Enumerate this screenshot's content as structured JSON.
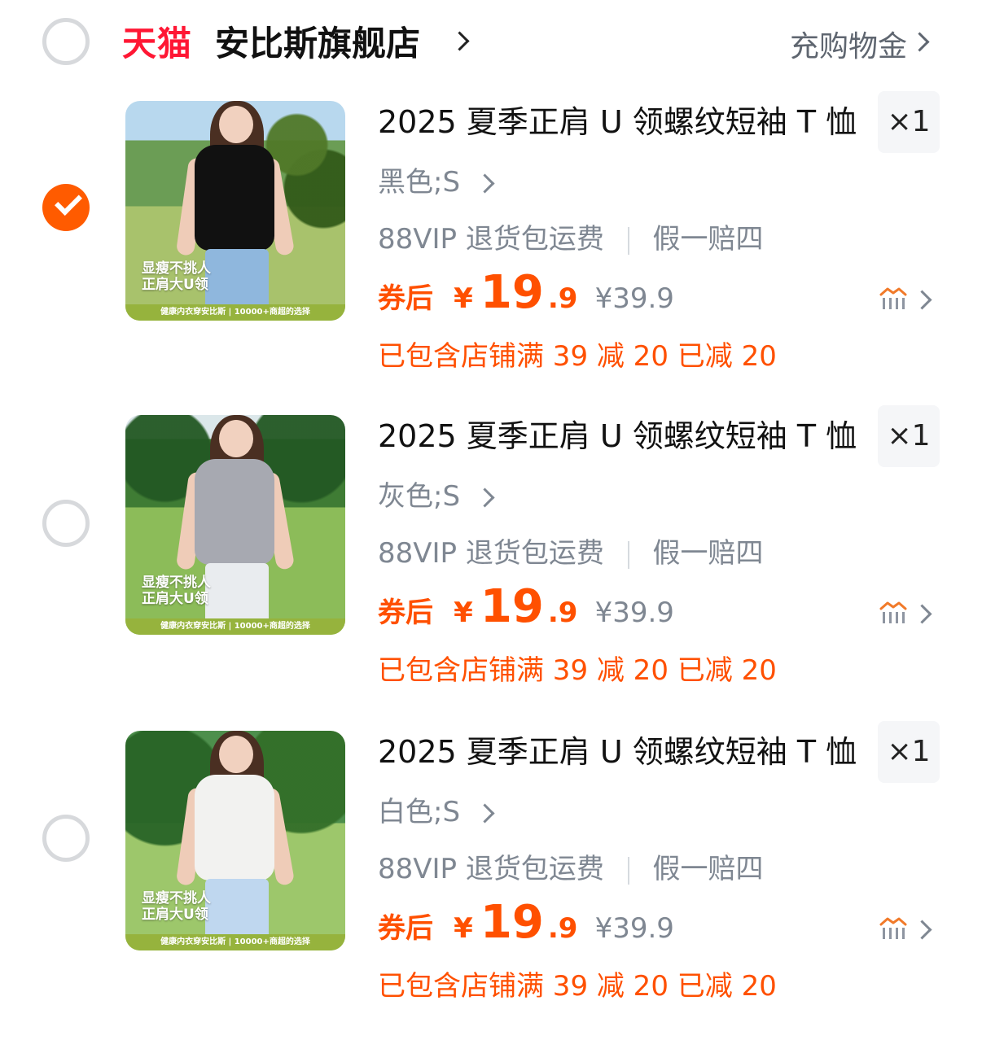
{
  "shop": {
    "platform": "天猫",
    "name": "安比斯旗舰店",
    "link_label": "充购物金"
  },
  "items": [
    {
      "selected": true,
      "title": "2025 夏季正肩 U 领螺纹短袖 T 恤",
      "quantity": "×1",
      "variant": "黑色;S",
      "service_1": "88VIP 退货包运费",
      "service_2": "假一赔四",
      "price_label": "券后",
      "currency": "¥",
      "price_int": "19",
      "price_dec": ".9",
      "original_price": "¥39.9",
      "promo": "已包含店铺满 39 减 20 已减 20",
      "image_text_1": "显瘦不挑人",
      "image_text_2": "正肩大U领",
      "image_footer": "健康内衣穿安比斯 | 10000+商超的选择"
    },
    {
      "selected": false,
      "title": "2025 夏季正肩 U 领螺纹短袖 T 恤",
      "quantity": "×1",
      "variant": "灰色;S",
      "service_1": "88VIP 退货包运费",
      "service_2": "假一赔四",
      "price_label": "券后",
      "currency": "¥",
      "price_int": "19",
      "price_dec": ".9",
      "original_price": "¥39.9",
      "promo": "已包含店铺满 39 减 20 已减 20",
      "image_text_1": "显瘦不挑人",
      "image_text_2": "正肩大U领",
      "image_footer": "健康内衣穿安比斯 | 10000+商超的选择"
    },
    {
      "selected": false,
      "title": "2025 夏季正肩 U 领螺纹短袖 T 恤",
      "quantity": "×1",
      "variant": "白色;S",
      "service_1": "88VIP 退货包运费",
      "service_2": "假一赔四",
      "price_label": "券后",
      "currency": "¥",
      "price_int": "19",
      "price_dec": ".9",
      "original_price": "¥39.9",
      "promo": "已包含店铺满 39 减 20 已减 20",
      "image_text_1": "显瘦不挑人",
      "image_text_2": "正肩大U领",
      "image_footer": "健康内衣穿安比斯 | 10000+商超的选择"
    }
  ],
  "colors": {
    "tmall_red": "#ff1734",
    "accent_orange": "#ff5000",
    "selected_orange": "#ff5b00",
    "muted_gray": "#7f8792"
  },
  "icons": {
    "header_checkbox": "radio-unchecked-icon",
    "selected_item": "check-icon",
    "price_trend": "price-trend-icon"
  }
}
